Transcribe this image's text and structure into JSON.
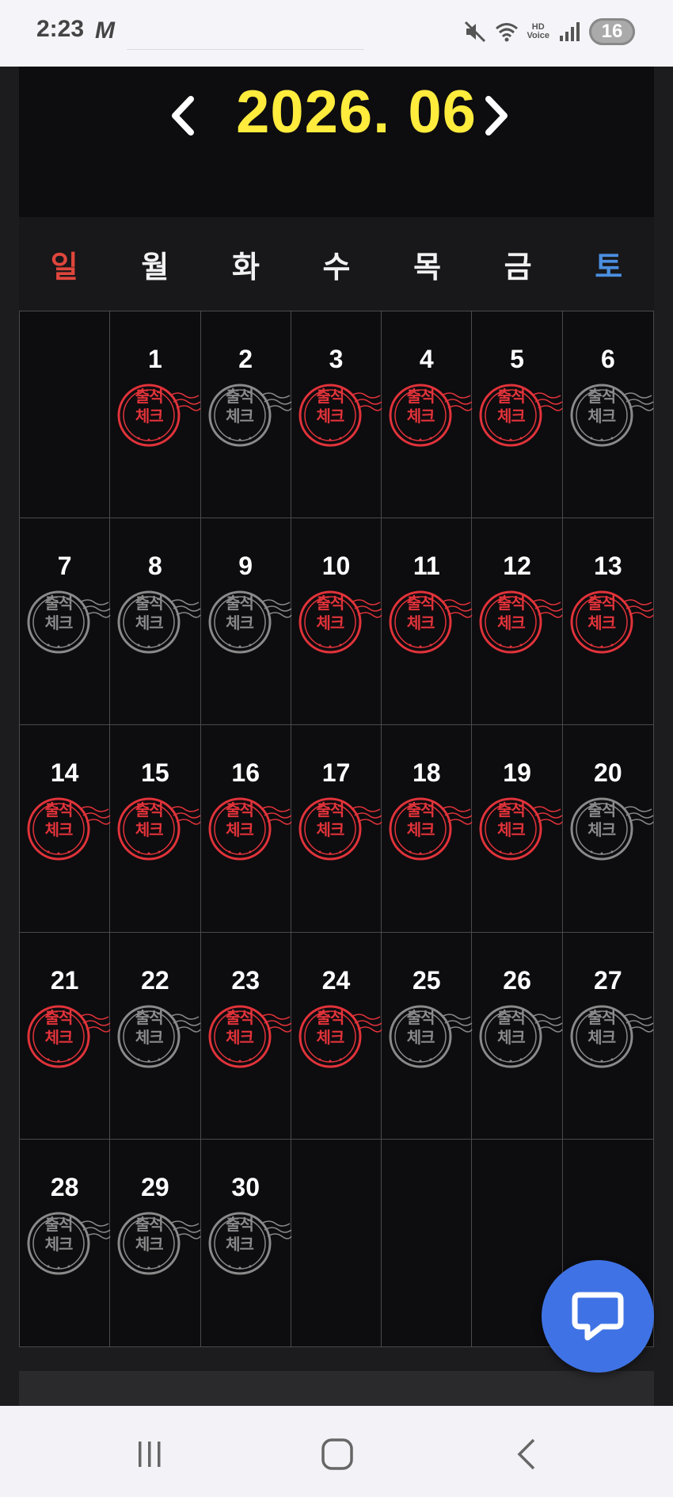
{
  "status_bar": {
    "time": "2:23",
    "app_glyph": "M",
    "hd_label": "HD",
    "voice_label": "Voice",
    "battery": "16",
    "icons": [
      "mute-icon",
      "wifi-icon",
      "hd-voice-icon",
      "signal-icon",
      "battery-icon"
    ]
  },
  "calendar": {
    "prev_icon": "chevron-left-icon",
    "next_icon": "chevron-right-icon",
    "month_title": "2026. 06",
    "weekdays": [
      "일",
      "월",
      "화",
      "수",
      "목",
      "금",
      "토"
    ],
    "weekday_colors": {
      "sun": "#e0463c",
      "sat": "#4a8fe0",
      "default": "#f2f2f2"
    },
    "stamp_text_line1": "출석",
    "stamp_text_line2": "체크",
    "stamp_colors": {
      "checked": "#e1333a",
      "unchecked": "#8a8a8a"
    },
    "leading_blank_days": 1,
    "days": [
      {
        "day": "1",
        "checked": true
      },
      {
        "day": "2",
        "checked": false
      },
      {
        "day": "3",
        "checked": true
      },
      {
        "day": "4",
        "checked": true
      },
      {
        "day": "5",
        "checked": true
      },
      {
        "day": "6",
        "checked": false
      },
      {
        "day": "7",
        "checked": false
      },
      {
        "day": "8",
        "checked": false
      },
      {
        "day": "9",
        "checked": false
      },
      {
        "day": "10",
        "checked": true
      },
      {
        "day": "11",
        "checked": true
      },
      {
        "day": "12",
        "checked": true
      },
      {
        "day": "13",
        "checked": true
      },
      {
        "day": "14",
        "checked": true
      },
      {
        "day": "15",
        "checked": true
      },
      {
        "day": "16",
        "checked": true
      },
      {
        "day": "17",
        "checked": true
      },
      {
        "day": "18",
        "checked": true
      },
      {
        "day": "19",
        "checked": true
      },
      {
        "day": "20",
        "checked": false
      },
      {
        "day": "21",
        "checked": true
      },
      {
        "day": "22",
        "checked": false
      },
      {
        "day": "23",
        "checked": true
      },
      {
        "day": "24",
        "checked": true
      },
      {
        "day": "25",
        "checked": false
      },
      {
        "day": "26",
        "checked": false
      },
      {
        "day": "27",
        "checked": false
      },
      {
        "day": "28",
        "checked": false
      },
      {
        "day": "29",
        "checked": false
      },
      {
        "day": "30",
        "checked": false
      }
    ]
  },
  "chat_button": {
    "icon": "chat-bubble-icon",
    "color": "#3f73e5"
  },
  "system_nav": {
    "icons": [
      "recent-apps-icon",
      "home-icon",
      "back-icon"
    ]
  }
}
